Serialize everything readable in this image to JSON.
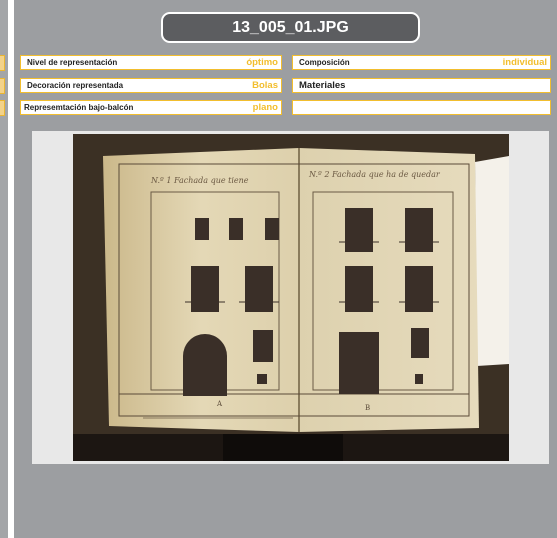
{
  "header": {
    "title": "13_005_01.JPG"
  },
  "fields": {
    "nivel": {
      "label": "Nivel de representación",
      "value": "óptimo"
    },
    "decoracion": {
      "label": "Decoración representada",
      "value": "Bolas"
    },
    "bajo_balcon": {
      "label": "Represemtación bajo-balcón",
      "value": "plano"
    },
    "composicion": {
      "label": "Composición",
      "value": "individual"
    },
    "materiales": {
      "label": "Materiales",
      "value": ""
    },
    "extra": {
      "value": ""
    }
  },
  "photo": {
    "left_caption": "N.º 1 Fachada que tiene",
    "right_caption": "N.º 2 Fachada que ha de quedar",
    "letter_a": "A",
    "letter_b": "B"
  },
  "colors": {
    "accent": "#f2be2e",
    "panel": "#9c9ea1",
    "title_bg": "#5c5d60"
  }
}
